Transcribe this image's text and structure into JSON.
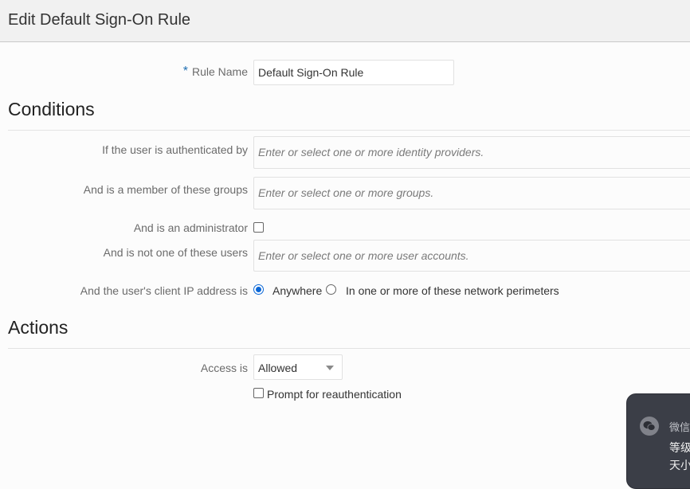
{
  "header": {
    "title": "Edit Default Sign-On Rule"
  },
  "rule_name": {
    "required_marker": "*",
    "label": "Rule Name",
    "value": "Default Sign-On Rule"
  },
  "conditions": {
    "title": "Conditions",
    "identity_providers": {
      "label": "If the user is authenticated by",
      "placeholder": "Enter or select one or more identity providers."
    },
    "groups": {
      "label": "And is a member of these groups",
      "placeholder": "Enter or select one or more groups."
    },
    "administrator": {
      "label": "And is an administrator",
      "checked": false
    },
    "excluded_users": {
      "label": "And is not one of these users",
      "placeholder": "Enter or select one or more user accounts."
    },
    "client_ip": {
      "label": "And the user's client IP address is",
      "options": [
        {
          "label": "Anywhere",
          "selected": true
        },
        {
          "label": "In one or more of these network perimeters",
          "selected": false
        }
      ]
    }
  },
  "actions": {
    "title": "Actions",
    "access": {
      "label": "Access is",
      "selected": "Allowed"
    },
    "reauth": {
      "label": "Prompt for reauthentication",
      "checked": false
    }
  },
  "notification": {
    "app": "微信",
    "lines": [
      "等级",
      "天小"
    ],
    "icon": "wechat-icon"
  }
}
